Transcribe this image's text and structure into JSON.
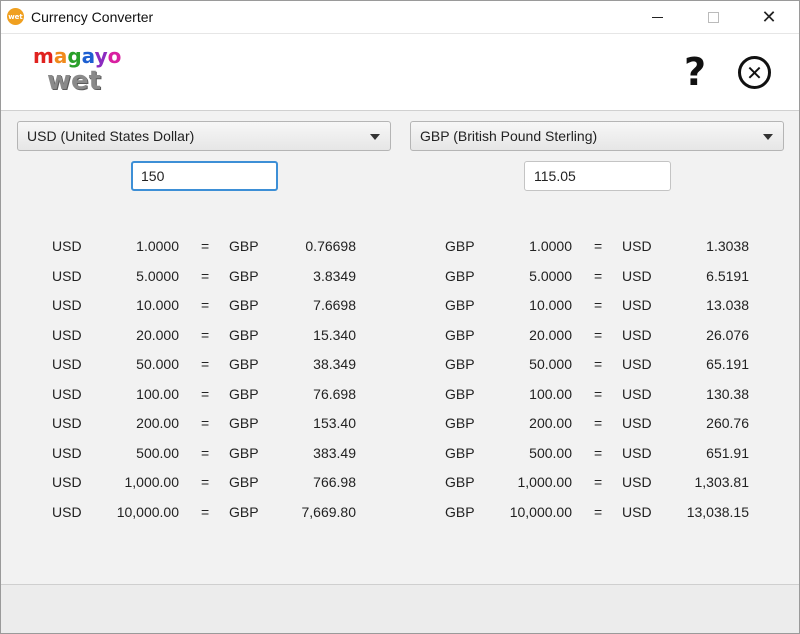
{
  "window": {
    "title": "Currency Converter",
    "app_icon_text": "wet",
    "minimize_icon": "minimize-icon",
    "maximize_icon": "maximize-icon",
    "close_glyph": "✕"
  },
  "header": {
    "logo_top": [
      "m",
      "a",
      "g",
      "a",
      "y",
      "o"
    ],
    "logo_bottom": "wet",
    "help_glyph": "?",
    "exit_glyph": "✕"
  },
  "from": {
    "currency": "USD (United States Dollar)",
    "amount": "150",
    "code": "USD"
  },
  "to": {
    "currency": "GBP (British Pound Sterling)",
    "amount": "115.05",
    "code": "GBP"
  },
  "equals": "=",
  "table_left": [
    {
      "from": "USD",
      "amount": "1.0000",
      "to": "GBP",
      "result": "0.76698"
    },
    {
      "from": "USD",
      "amount": "5.0000",
      "to": "GBP",
      "result": "3.8349"
    },
    {
      "from": "USD",
      "amount": "10.000",
      "to": "GBP",
      "result": "7.6698"
    },
    {
      "from": "USD",
      "amount": "20.000",
      "to": "GBP",
      "result": "15.340"
    },
    {
      "from": "USD",
      "amount": "50.000",
      "to": "GBP",
      "result": "38.349"
    },
    {
      "from": "USD",
      "amount": "100.00",
      "to": "GBP",
      "result": "76.698"
    },
    {
      "from": "USD",
      "amount": "200.00",
      "to": "GBP",
      "result": "153.40"
    },
    {
      "from": "USD",
      "amount": "500.00",
      "to": "GBP",
      "result": "383.49"
    },
    {
      "from": "USD",
      "amount": "1,000.00",
      "to": "GBP",
      "result": "766.98"
    },
    {
      "from": "USD",
      "amount": "10,000.00",
      "to": "GBP",
      "result": "7,669.80"
    }
  ],
  "table_right": [
    {
      "from": "GBP",
      "amount": "1.0000",
      "to": "USD",
      "result": "1.3038"
    },
    {
      "from": "GBP",
      "amount": "5.0000",
      "to": "USD",
      "result": "6.5191"
    },
    {
      "from": "GBP",
      "amount": "10.000",
      "to": "USD",
      "result": "13.038"
    },
    {
      "from": "GBP",
      "amount": "20.000",
      "to": "USD",
      "result": "26.076"
    },
    {
      "from": "GBP",
      "amount": "50.000",
      "to": "USD",
      "result": "65.191"
    },
    {
      "from": "GBP",
      "amount": "100.00",
      "to": "USD",
      "result": "130.38"
    },
    {
      "from": "GBP",
      "amount": "200.00",
      "to": "USD",
      "result": "260.76"
    },
    {
      "from": "GBP",
      "amount": "500.00",
      "to": "USD",
      "result": "651.91"
    },
    {
      "from": "GBP",
      "amount": "1,000.00",
      "to": "USD",
      "result": "1,303.81"
    },
    {
      "from": "GBP",
      "amount": "10,000.00",
      "to": "USD",
      "result": "13,038.15"
    }
  ]
}
